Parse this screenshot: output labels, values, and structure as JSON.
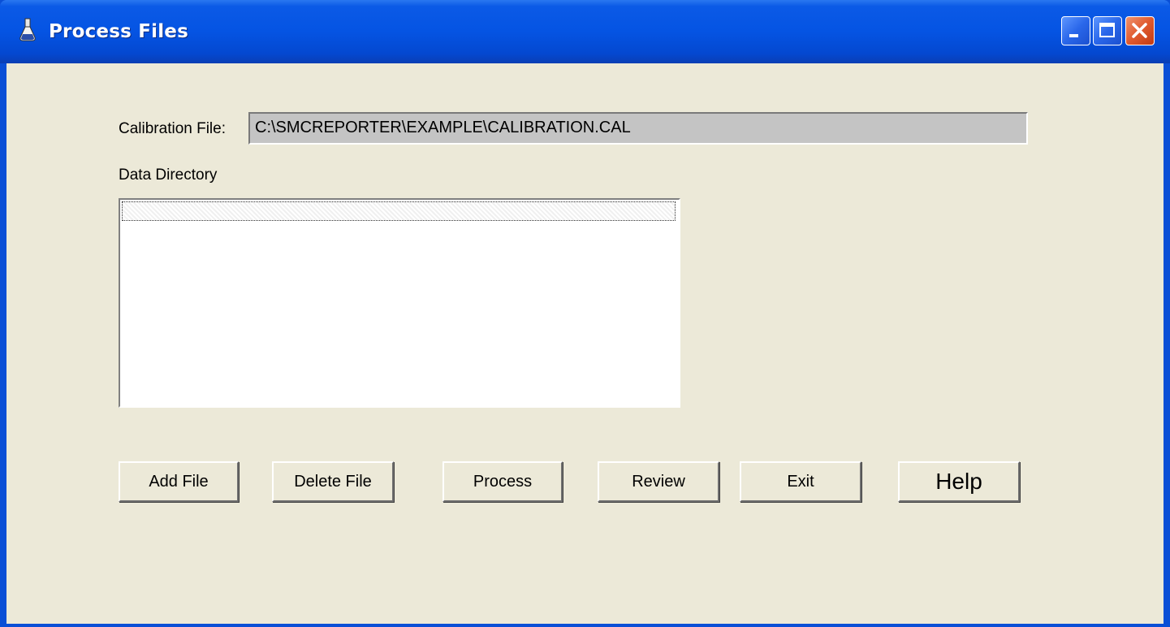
{
  "window": {
    "title": "Process Files",
    "icon": "flask-icon",
    "controls": {
      "minimize": "minimize-icon",
      "maximize": "maximize-icon",
      "close": "close-icon"
    }
  },
  "form": {
    "calibration_label": "Calibration File:",
    "calibration_value": "C:\\SMCREPORTER\\EXAMPLE\\CALIBRATION.CAL",
    "data_directory_label": "Data Directory",
    "data_directory_items": []
  },
  "buttons": {
    "add_file": "Add File",
    "delete_file": "Delete File",
    "process": "Process",
    "review": "Review",
    "exit": "Exit",
    "help": "Help"
  },
  "colors": {
    "title_bar": "#0554e3",
    "client_bg": "#ece9d8",
    "close_button": "#e05a2e"
  }
}
